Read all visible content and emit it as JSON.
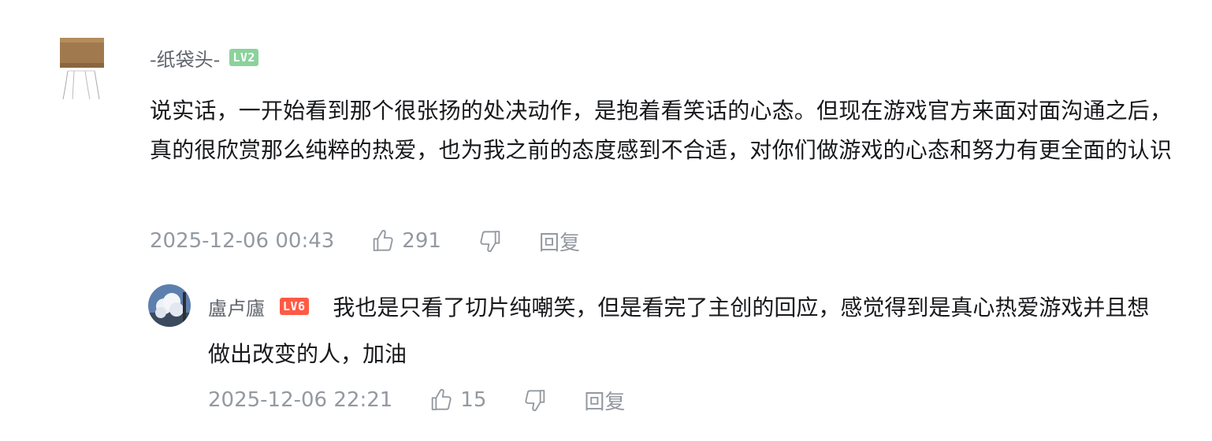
{
  "comment": {
    "username": "-纸袋头-",
    "level": "LV2",
    "content": "说实话，一开始看到那个很张扬的处决动作，是抱着看笑话的心态。但现在游戏官方来面对面沟通之后，真的很欣赏那么纯粹的热爱，也为我之前的态度感到不合适，对你们做游戏的心态和努力有更全面的认识",
    "time": "2025-12-06 00:43",
    "likes": "291",
    "reply_label": "回复"
  },
  "reply": {
    "username": "盧卢廬",
    "level": "LV6",
    "content": "我也是只看了切片纯嘲笑，但是看完了主创的回应，感觉得到是真心热爱游戏并且想做出改变的人，加油",
    "time": "2025-12-06 22:21",
    "likes": "15",
    "reply_label": "回复"
  },
  "icons": {
    "like": "thumbs-up-icon",
    "dislike": "thumbs-down-icon"
  },
  "colors": {
    "meta_text": "#9499a0",
    "username": "#61666d",
    "lv2_badge": "#8bd29b",
    "lv6_badge": "#ff5a45"
  }
}
